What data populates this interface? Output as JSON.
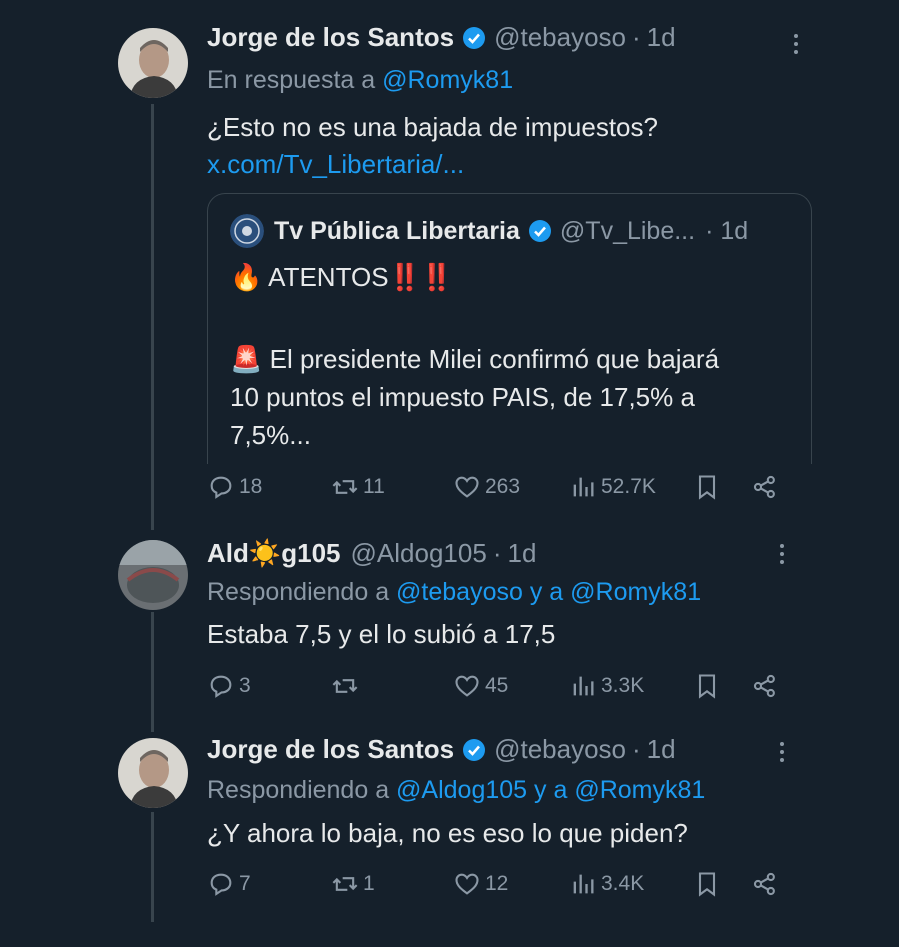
{
  "tweets": [
    {
      "name": "Jorge de los Santos",
      "handle": "@tebayoso",
      "time": "1d",
      "reply_prefix": "En respuesta a",
      "reply_mentions": "@Romyk81",
      "text": "¿Esto no es una bajada de impuestos?",
      "link": "x.com/Tv_Libertaria/...",
      "quote": {
        "name": "Tv Pública Libertaria",
        "handle": "@Tv_Libe...",
        "time": "· 1d",
        "line1": "🔥 ATENTOS‼️‼️",
        "line2": "🚨 El presidente Milei confirmó que bajará",
        "line3": "10 puntos el impuesto PAIS, de 17,5% a",
        "line4": "7,5%..."
      },
      "replies": "18",
      "retweets": "11",
      "likes": "263",
      "views": "52.7K"
    },
    {
      "name": "Ald☀️g105",
      "handle": "@Aldog105",
      "time": "1d",
      "reply_prefix": "Respondiendo a",
      "reply_mentions": "@tebayoso y a @Romyk81",
      "text": "Estaba 7,5 y el lo subió a 17,5",
      "replies": "3",
      "retweets": "",
      "likes": "45",
      "views": "3.3K"
    },
    {
      "name": "Jorge de los Santos",
      "handle": "@tebayoso",
      "time": "1d",
      "reply_prefix": "Respondiendo a",
      "reply_mentions": "@Aldog105 y a @Romyk81",
      "text": "¿Y ahora lo baja, no es eso lo que piden?",
      "replies": "7",
      "retweets": "1",
      "likes": "12",
      "views": "3.4K"
    }
  ],
  "colors": {
    "background": "#15202b",
    "accent": "#1d9bf0",
    "muted": "#8b98a5",
    "border": "#38444d"
  },
  "icons": [
    "verified-icon",
    "more-icon",
    "reply-icon",
    "retweet-icon",
    "like-icon",
    "views-icon",
    "bookmark-icon",
    "share-icon"
  ]
}
